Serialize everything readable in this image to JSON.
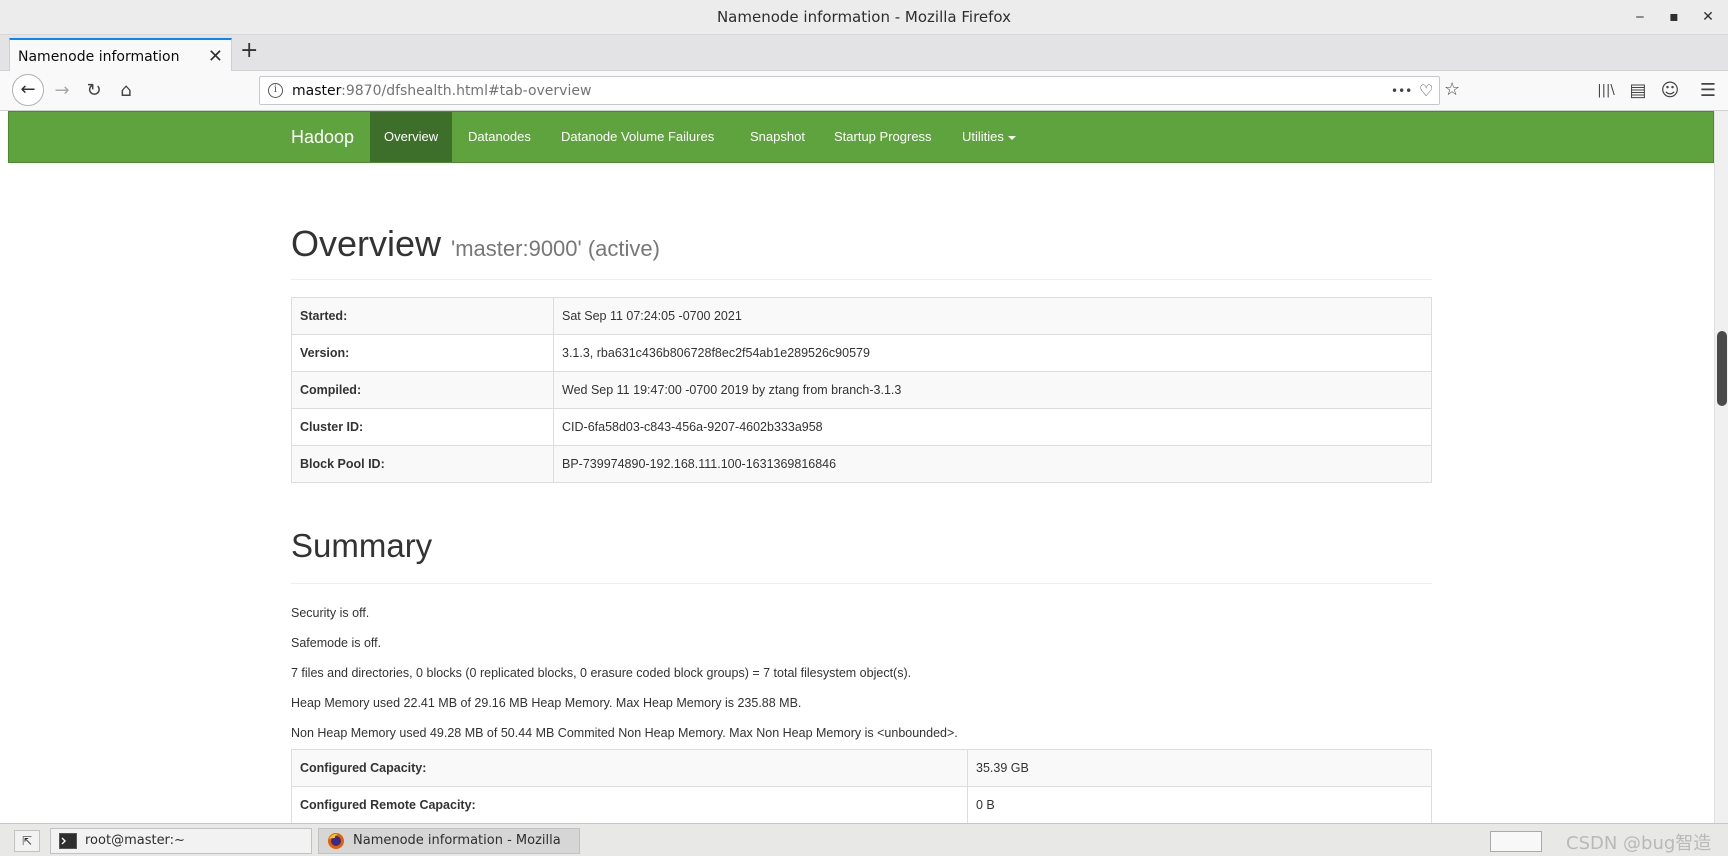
{
  "window": {
    "title": "Namenode information - Mozilla Firefox",
    "minimize": "‒",
    "maximize": "▪",
    "close": "✕"
  },
  "tabs": {
    "active_label": "Namenode information",
    "close_glyph": "✕",
    "new_tab_glyph": "+"
  },
  "toolbar": {
    "back_glyph": "←",
    "forward_glyph": "→",
    "reload_glyph": "↻",
    "home_glyph": "⌂",
    "info_glyph": "i",
    "url_host": "master",
    "url_path": ":9870/dfshealth.html#tab-overview",
    "more_glyph": "•••",
    "pocket_glyph": "♡",
    "star_glyph": "☆",
    "library_glyph": "|||\\",
    "sidebar_glyph": "▤",
    "account_glyph": "☺",
    "menu_glyph": "☰"
  },
  "hadoop_nav": {
    "brand": "Hadoop",
    "items": [
      {
        "label": "Overview"
      },
      {
        "label": "Datanodes"
      },
      {
        "label": "Datanode Volume Failures"
      },
      {
        "label": "Snapshot"
      },
      {
        "label": "Startup Progress"
      },
      {
        "label": "Utilities"
      }
    ]
  },
  "overview": {
    "heading": "Overview",
    "subheading": "'master:9000' (active)",
    "rows": [
      {
        "key": "Started:",
        "value": "Sat Sep 11 07:24:05 -0700 2021"
      },
      {
        "key": "Version:",
        "value": "3.1.3, rba631c436b806728f8ec2f54ab1e289526c90579"
      },
      {
        "key": "Compiled:",
        "value": "Wed Sep 11 19:47:00 -0700 2019 by ztang from branch-3.1.3"
      },
      {
        "key": "Cluster ID:",
        "value": "CID-6fa58d03-c843-456a-9207-4602b333a958"
      },
      {
        "key": "Block Pool ID:",
        "value": "BP-739974890-192.168.111.100-1631369816846"
      }
    ]
  },
  "summary": {
    "heading": "Summary",
    "lines": [
      "Security is off.",
      "Safemode is off.",
      "7 files and directories, 0 blocks (0 replicated blocks, 0 erasure coded block groups) = 7 total filesystem object(s).",
      "Heap Memory used 22.41 MB of 29.16 MB Heap Memory. Max Heap Memory is 235.88 MB.",
      "Non Heap Memory used 49.28 MB of 50.44 MB Commited Non Heap Memory. Max Non Heap Memory is <unbounded>."
    ],
    "rows": [
      {
        "key": "Configured Capacity:",
        "value": "35.39 GB"
      },
      {
        "key": "Configured Remote Capacity:",
        "value": "0 B"
      }
    ]
  },
  "taskbar": {
    "tasks": [
      {
        "label": "root@master:~"
      },
      {
        "label": "Namenode information - Mozilla Fir···"
      }
    ],
    "watermark": "CSDN @bug智造"
  },
  "colors": {
    "hadoop_green": "#5fa33e",
    "hadoop_green_active": "#3d6e2a",
    "firefox_blue": "#0a84ff"
  }
}
